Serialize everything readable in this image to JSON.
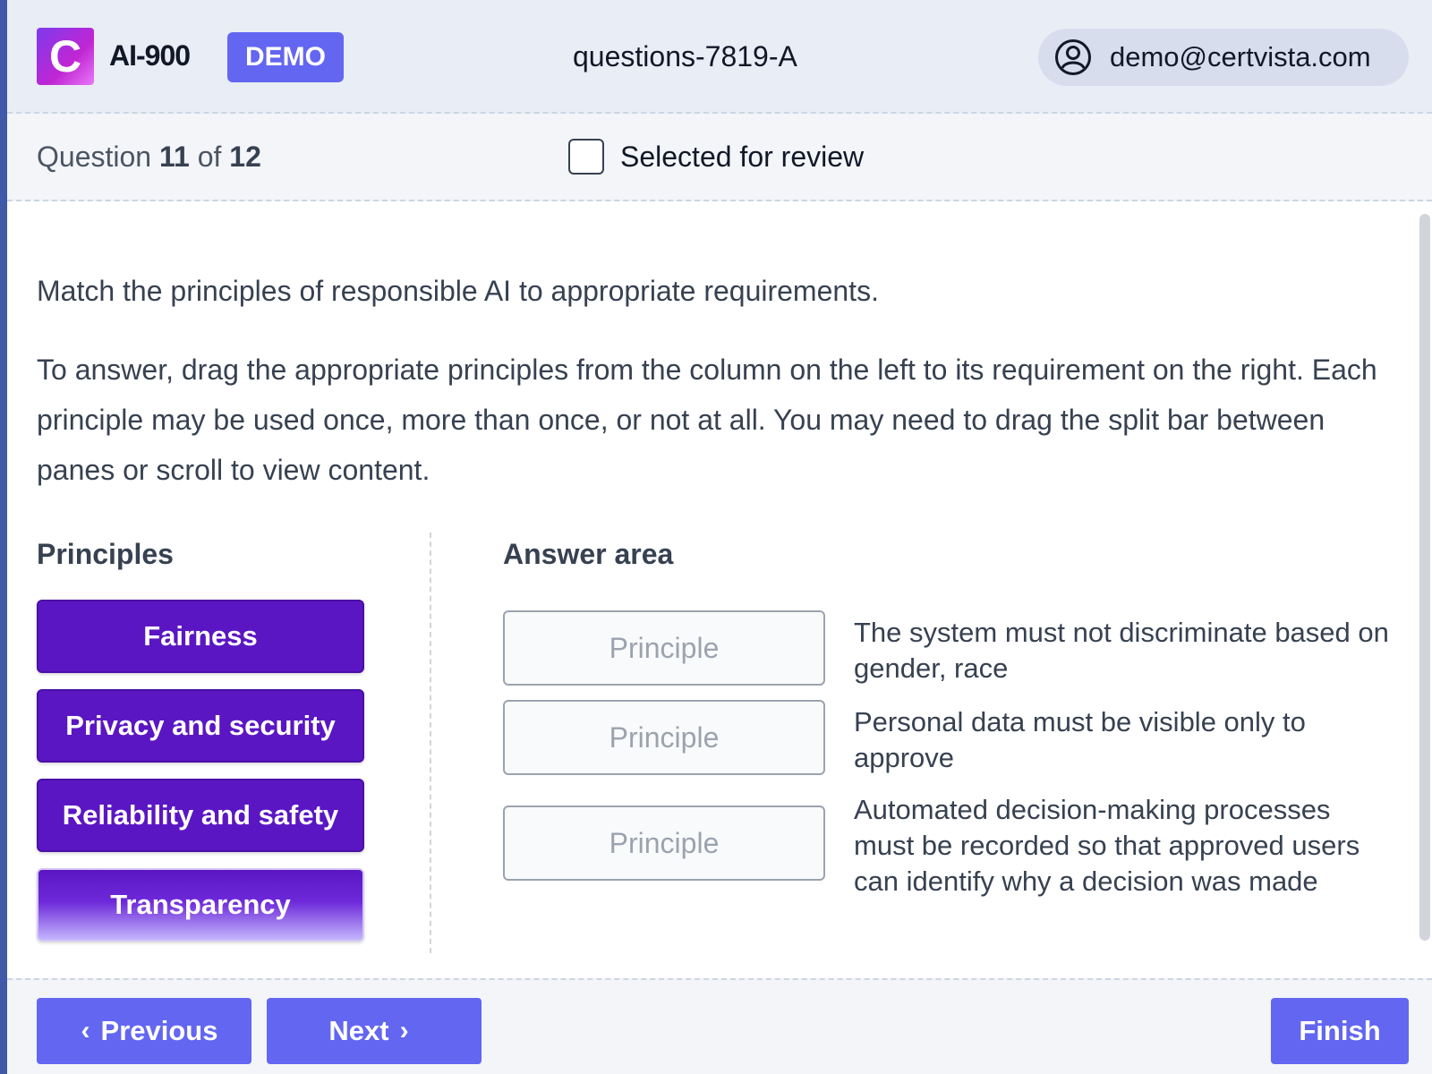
{
  "header": {
    "logo_letter": "C",
    "exam_code": "AI-900",
    "badge": "DEMO",
    "questions_id": "questions-7819-A",
    "user_email": "demo@certvista.com"
  },
  "progress": {
    "prefix": "Question",
    "current": "11",
    "of_label": "of",
    "total": "12"
  },
  "review": {
    "label": "Selected for review",
    "checked": false
  },
  "question": {
    "prompt": "Match the principles of responsible AI to appropriate requirements.",
    "instructions": "To answer, drag the appropriate principles from the column on the left to its requirement on the right. Each principle may be used once, more than once, or not at all. You may need to drag the split bar between panes or scroll to view content."
  },
  "principles": {
    "title": "Principles",
    "items": [
      "Fairness",
      "Privacy and security",
      "Reliability and safety",
      "Transparency"
    ]
  },
  "answer_area": {
    "title": "Answer area",
    "placeholder": "Principle",
    "requirements": [
      "The system must not discriminate based on gender, race",
      "Personal data must be visible only to approve",
      "Automated decision-making processes must be recorded so that approved users can identify why a decision was made"
    ]
  },
  "footer": {
    "previous": "Previous",
    "next": "Next",
    "finish": "Finish"
  },
  "colors": {
    "accent": "#6366f1",
    "principle": "#5b16c3",
    "header_bg": "#e9edf5"
  }
}
